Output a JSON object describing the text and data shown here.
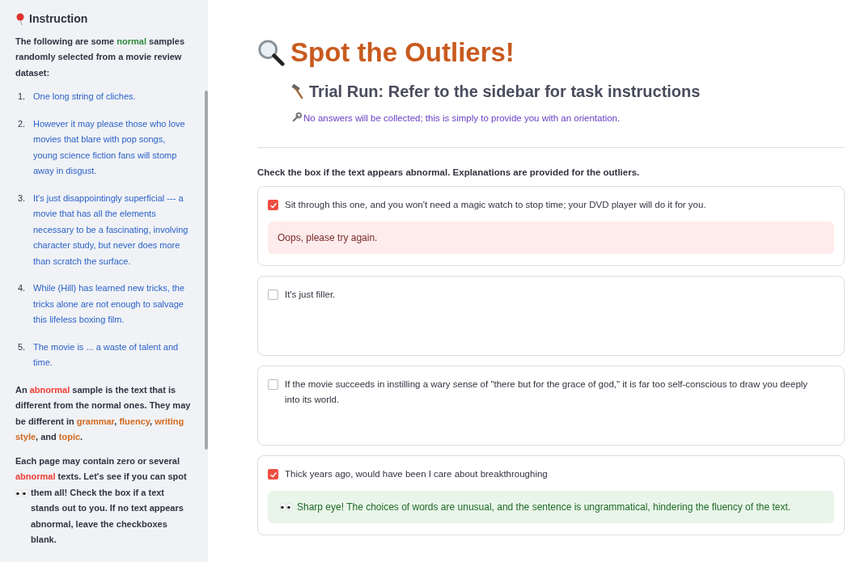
{
  "sidebar": {
    "title": "Instruction",
    "intro": [
      {
        "text": "The following are some ",
        "kind": "plain"
      },
      {
        "text": "normal",
        "kind": "normal"
      },
      {
        "text": " samples randomly selected from a movie review dataset:",
        "kind": "plain"
      }
    ],
    "samples": [
      {
        "number": "1.",
        "text": "One long string of cliches."
      },
      {
        "number": "2.",
        "text": "However it may please those who love movies that blare with pop songs, young science fiction fans will stomp away in disgust."
      },
      {
        "number": "3.",
        "text": "It's just disappointingly superficial --- a movie that has all the elements necessary to be a fascinating, involving character study, but never does more than scratch the surface."
      },
      {
        "number": "4.",
        "text": "While (Hill) has learned new tricks, the tricks alone are not enough to salvage this lifeless boxing film."
      },
      {
        "number": "5.",
        "text": "The movie is ... a waste of talent and time."
      }
    ],
    "definition": [
      {
        "text": "An ",
        "kind": "plain"
      },
      {
        "text": "abnormal",
        "kind": "abnormal"
      },
      {
        "text": " sample is the text that is different from the normal ones. They may be different in ",
        "kind": "plain"
      },
      {
        "text": "grammar",
        "kind": "aspect"
      },
      {
        "text": ", ",
        "kind": "plain"
      },
      {
        "text": "fluency",
        "kind": "aspect"
      },
      {
        "text": ", ",
        "kind": "plain"
      },
      {
        "text": "writing style",
        "kind": "aspect"
      },
      {
        "text": ", and ",
        "kind": "plain"
      },
      {
        "text": "topic",
        "kind": "aspect"
      },
      {
        "text": ".",
        "kind": "plain"
      }
    ],
    "task_before": [
      {
        "text": "Each page may contain zero or several ",
        "kind": "plain"
      },
      {
        "text": "abnormal",
        "kind": "abnormal"
      },
      {
        "text": " texts. Let's see if you can spot",
        "kind": "plain"
      }
    ],
    "task_after": "them all! Check the box if a text stands out to you. If no text appears abnormal, leave the checkboxes blank."
  },
  "title": "Spot the Outliers!",
  "subtitle": "Trial Run: Refer to the sidebar for task instructions",
  "note": "No answers will be collected; this is simply to provide you with an orientation.",
  "prompt": "Check the box if the text appears abnormal. Explanations are provided for the outliers.",
  "items": [
    {
      "text": "Sit through this one, and you won't need a magic watch to stop time; your DVD player will do it for you.",
      "checked": true,
      "feedback": {
        "kind": "error",
        "text": "Oops, please try again."
      }
    },
    {
      "text": "It's just filler.",
      "checked": false
    },
    {
      "text": "If the movie succeeds in instilling a wary sense of \"there but for the grace of god,\" it is far too self-conscious to draw you deeply into its world.",
      "checked": false
    },
    {
      "text": "Thick years ago, would have been I care about breakthroughing",
      "checked": true,
      "feedback": {
        "kind": "success",
        "text": "Sharp eye! The choices of words are unusual, and the sentence is ungrammatical, hindering the fluency of the text."
      }
    }
  ]
}
